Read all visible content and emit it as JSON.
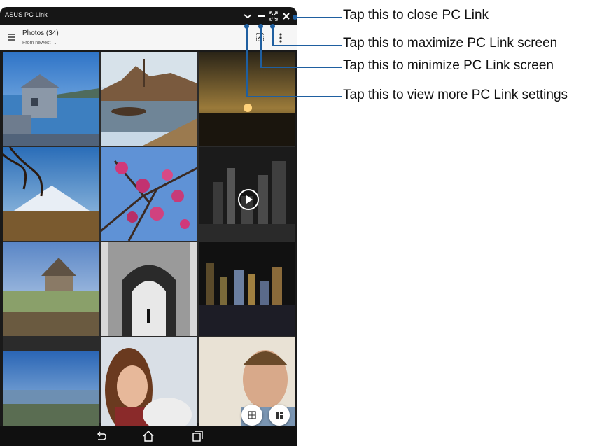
{
  "window": {
    "title": "ASUS PC Link",
    "controls": [
      "chevron-down-icon",
      "minimize-icon",
      "maximize-icon",
      "close-icon"
    ]
  },
  "appbar": {
    "title": "Photos (34)",
    "sort_label": "From newest"
  },
  "gallery": {
    "photos": [
      "lake-pier-house",
      "pirate-ship-harbor",
      "sunset-field",
      "mount-fuji",
      "pink-blossoms",
      "city-night-video",
      "stone-church",
      "arched-gate-bw",
      "night-skyline",
      "coast-landscape",
      "smiling-woman",
      "smiling-man"
    ]
  },
  "navigation": [
    "back-icon",
    "home-icon",
    "recent-apps-icon"
  ],
  "callouts": [
    "Tap this to close PC Link",
    "Tap this to maximize PC Link screen",
    "Tap this to minimize PC Link screen",
    "Tap this to view more PC Link settings"
  ],
  "colors": {
    "callout": "#1f5fa0",
    "titlebar": "#161616",
    "appbar": "#f6f6f6"
  }
}
